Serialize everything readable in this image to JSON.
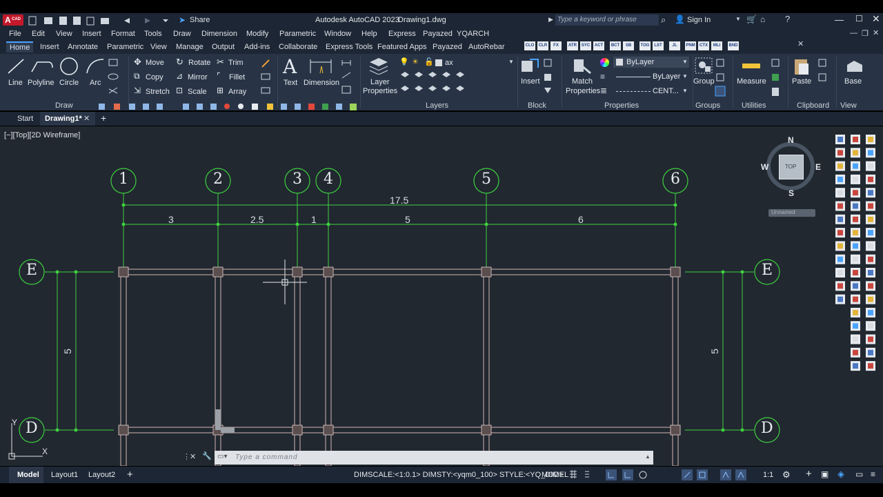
{
  "title_bar": {
    "app_badge": "A",
    "app_badge_sub": "CAD",
    "share_label": "Share",
    "app_title": "Autodesk AutoCAD 2023",
    "file_title": "Drawing1.dwg",
    "search_placeholder": "Type a keyword or phrase",
    "sign_in": "Sign In"
  },
  "menu": [
    "File",
    "Edit",
    "View",
    "Insert",
    "Format",
    "Tools",
    "Draw",
    "Dimension",
    "Modify",
    "Parametric",
    "Window",
    "Help",
    "Express",
    "Payazed",
    "YQARCH"
  ],
  "ribbon_tabs": [
    "Home",
    "Insert",
    "Annotate",
    "Parametric",
    "View",
    "Manage",
    "Output",
    "Add-ins",
    "Collaborate",
    "Express Tools",
    "Featured Apps",
    "Payazed",
    "AutoRebar"
  ],
  "ribbon_custom_buttons": [
    "CLO",
    "CLR",
    "FX",
    "ATR",
    "SYC",
    "ACT",
    "BCT",
    "SB",
    "TOG",
    "LST",
    "JL",
    "PNM",
    "CTX",
    "MLI",
    "BND"
  ],
  "ribbon": {
    "draw": {
      "line": "Line",
      "polyline": "Polyline",
      "circle": "Circle",
      "arc": "Arc",
      "title": "Draw"
    },
    "modify": {
      "move": "Move",
      "rotate": "Rotate",
      "trim": "Trim",
      "copy": "Copy",
      "mirror": "Mirror",
      "fillet": "Fillet",
      "stretch": "Stretch",
      "scale": "Scale",
      "array": "Array"
    },
    "annotation": {
      "text": "Text",
      "dimension": "Dimension"
    },
    "layers": {
      "layer_properties_1": "Layer",
      "layer_properties_2": "Properties",
      "current_layer": "ax",
      "title": "Layers"
    },
    "block": {
      "insert": "Insert",
      "title": "Block"
    },
    "properties": {
      "match_1": "Match",
      "match_2": "Properties",
      "color": "ByLayer",
      "lineweight": "ByLayer",
      "linetype": "CENT...",
      "title": "Properties"
    },
    "groups": {
      "group": "Group",
      "title": "Groups"
    },
    "utilities": {
      "measure": "Measure",
      "title": "Utilities"
    },
    "clipboard": {
      "paste": "Paste",
      "title": "Clipboard"
    },
    "view": {
      "base": "Base",
      "title": "View"
    }
  },
  "doc_tabs": {
    "start": "Start",
    "drawing": "Drawing1*"
  },
  "viewport_label": "[−][Top][2D Wireframe]",
  "viewcube": {
    "n": "N",
    "s": "S",
    "e": "E",
    "w": "W",
    "top": "TOP",
    "wcs": "Unnamed"
  },
  "grid": {
    "columns": [
      "1",
      "2",
      "3",
      "4",
      "5",
      "6"
    ],
    "rows": [
      "E",
      "D"
    ],
    "total_dim": "17.5",
    "span_dims": [
      "3",
      "2.5",
      "1",
      "5",
      "6"
    ],
    "row_dim_left": "5",
    "row_dim_right": "5"
  },
  "ucs": {
    "y": "Y",
    "x": "X"
  },
  "command_line": {
    "placeholder": "Type a command"
  },
  "status": {
    "layout_tabs": [
      "Model",
      "Layout1",
      "Layout2"
    ],
    "add_tab": "+",
    "dimscale": "DIMSCALE:<1:0.1> DIMSTY:<yqm0_100> STYLE:<YQ_DIM>",
    "model": "MODEL",
    "scale": "1:1"
  },
  "colors": {
    "accent": "#4aa3ff",
    "grid_green": "#3fd13f",
    "canvas": "#212830",
    "wall": "#b89f9f"
  }
}
